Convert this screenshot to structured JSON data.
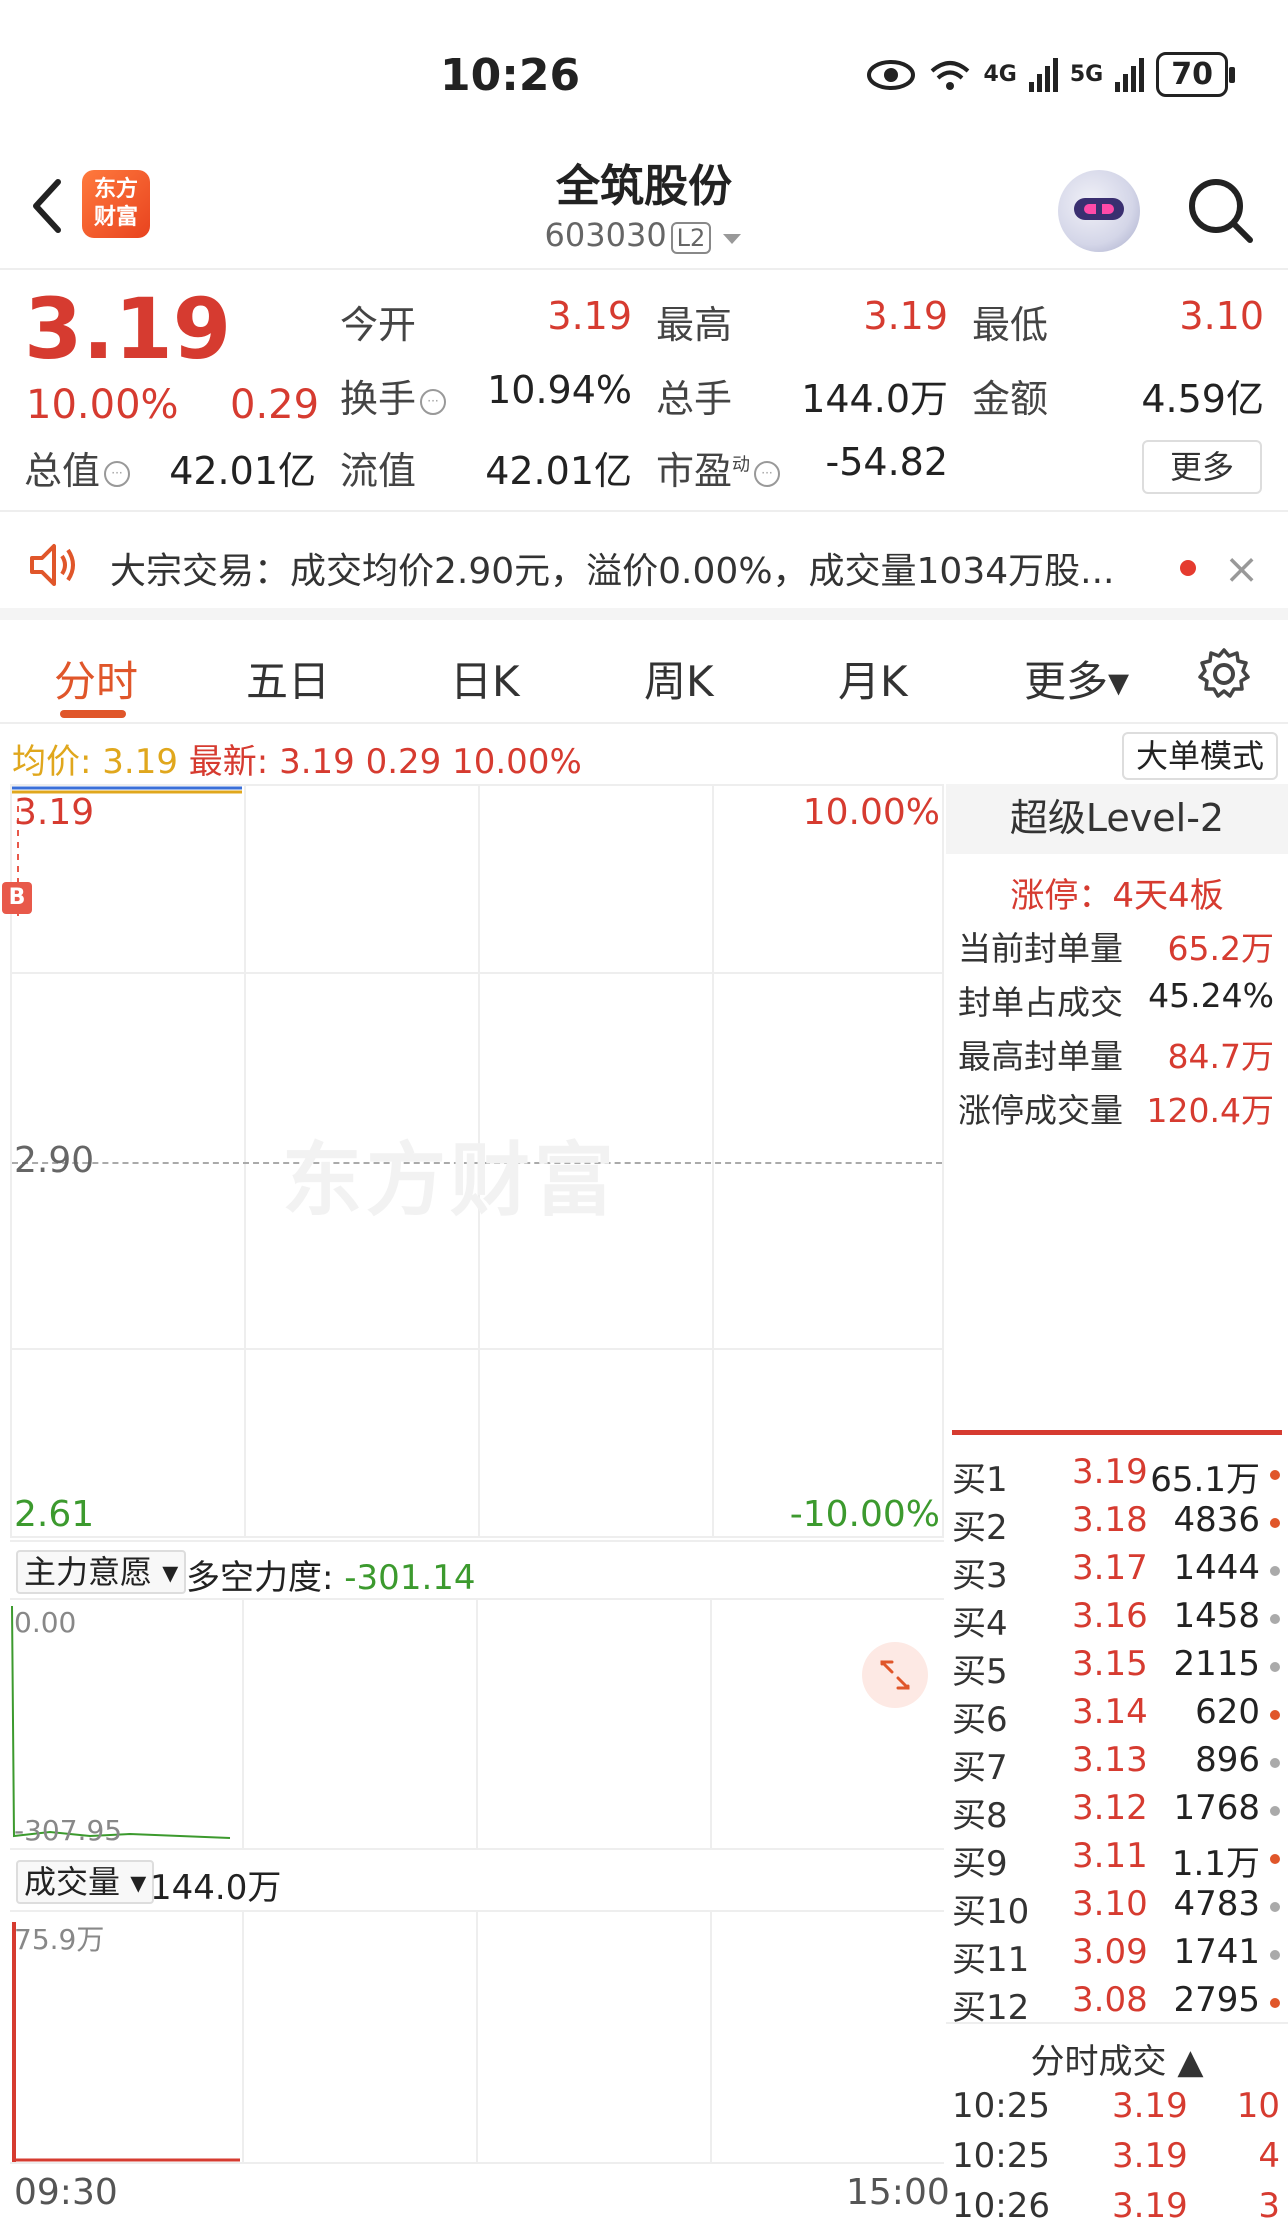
{
  "status": {
    "time": "10:26",
    "network1": "4G",
    "network2": "5G",
    "battery": "70"
  },
  "nav": {
    "title": "全筑股份",
    "code": "603030",
    "level_badge": "L2",
    "logo_text_1": "东方",
    "logo_text_2": "财富"
  },
  "quote": {
    "price": "3.19",
    "pct": "10.00%",
    "change": "0.29",
    "open_label": "今开",
    "open": "3.19",
    "high_label": "最高",
    "high": "3.19",
    "low_label": "最低",
    "low": "3.10",
    "turnover_label": "换手",
    "turnover": "10.94%",
    "volume_label": "总手",
    "volume": "144.0万",
    "amount_label": "金额",
    "amount": "4.59亿",
    "mktcap_label": "总值",
    "mktcap": "42.01亿",
    "float_label": "流值",
    "float": "42.01亿",
    "pe_label": "市盈",
    "pe_sup": "动",
    "pe": "-54.82",
    "more_label": "更多"
  },
  "notice": {
    "text": "大宗交易：成交均价2.90元，溢价0.00%，成交量1034万股...",
    "close": "×"
  },
  "tabs": [
    "分时",
    "五日",
    "日K",
    "周K",
    "月K",
    "更多▾"
  ],
  "legend": {
    "avg_label": "均价:",
    "avg": "3.19",
    "latest_label": "最新:",
    "latest": "3.19",
    "change": "0.29",
    "pct": "10.00%",
    "mode_button": "大单模式"
  },
  "chart": {
    "y_top": "3.19",
    "y_mid": "2.90",
    "y_bottom": "2.61",
    "pct_top": "10.00%",
    "pct_bottom": "-10.00%",
    "watermark": "东方财富",
    "buy_marker": "B",
    "time_start": "09:30",
    "time_end": "15:00",
    "price_series": [
      3.19,
      3.19,
      3.19,
      3.19
    ]
  },
  "level2": {
    "title": "超级Level-2",
    "limit_up_label": "涨停：",
    "limit_up_value": "4天4板",
    "rows": [
      {
        "label": "当前封单量",
        "value": "65.2万"
      },
      {
        "label": "封单占成交",
        "value": "45.24%"
      },
      {
        "label": "最高封单量",
        "value": "84.7万"
      },
      {
        "label": "涨停成交量",
        "value": "120.4万"
      }
    ],
    "bids": [
      {
        "label": "买1",
        "price": "3.19",
        "volume": "65.1万",
        "dot": "#e0562a"
      },
      {
        "label": "买2",
        "price": "3.18",
        "volume": "4836",
        "dot": "#e0562a"
      },
      {
        "label": "买3",
        "price": "3.17",
        "volume": "1444",
        "dot": "#aaaaaa"
      },
      {
        "label": "买4",
        "price": "3.16",
        "volume": "1458",
        "dot": "#aaaaaa"
      },
      {
        "label": "买5",
        "price": "3.15",
        "volume": "2115",
        "dot": "#aaaaaa"
      },
      {
        "label": "买6",
        "price": "3.14",
        "volume": "620",
        "dot": "#e0562a"
      },
      {
        "label": "买7",
        "price": "3.13",
        "volume": "896",
        "dot": "#aaaaaa"
      },
      {
        "label": "买8",
        "price": "3.12",
        "volume": "1768",
        "dot": "#aaaaaa"
      },
      {
        "label": "买9",
        "price": "3.11",
        "volume": "1.1万",
        "dot": "#e0562a"
      },
      {
        "label": "买10",
        "price": "3.10",
        "volume": "4783",
        "dot": "#aaaaaa"
      },
      {
        "label": "买11",
        "price": "3.09",
        "volume": "1741",
        "dot": "#aaaaaa"
      },
      {
        "label": "买12",
        "price": "3.08",
        "volume": "2795",
        "dot": "#e0562a"
      }
    ],
    "ticks_title": "分时成交",
    "ticks": [
      {
        "time": "10:25",
        "price": "3.19",
        "count": "10"
      },
      {
        "time": "10:25",
        "price": "3.19",
        "count": "4"
      },
      {
        "time": "10:26",
        "price": "3.19",
        "count": "3"
      }
    ]
  },
  "sub1": {
    "dropdown": "主力意愿",
    "indicator_label": "多空力度:",
    "indicator_value": "-301.14",
    "top_label": "0.00",
    "bottom_label": "-307.95"
  },
  "sub2": {
    "dropdown": "成交量",
    "volume": "144.0万",
    "top_label": "75.9万"
  }
}
